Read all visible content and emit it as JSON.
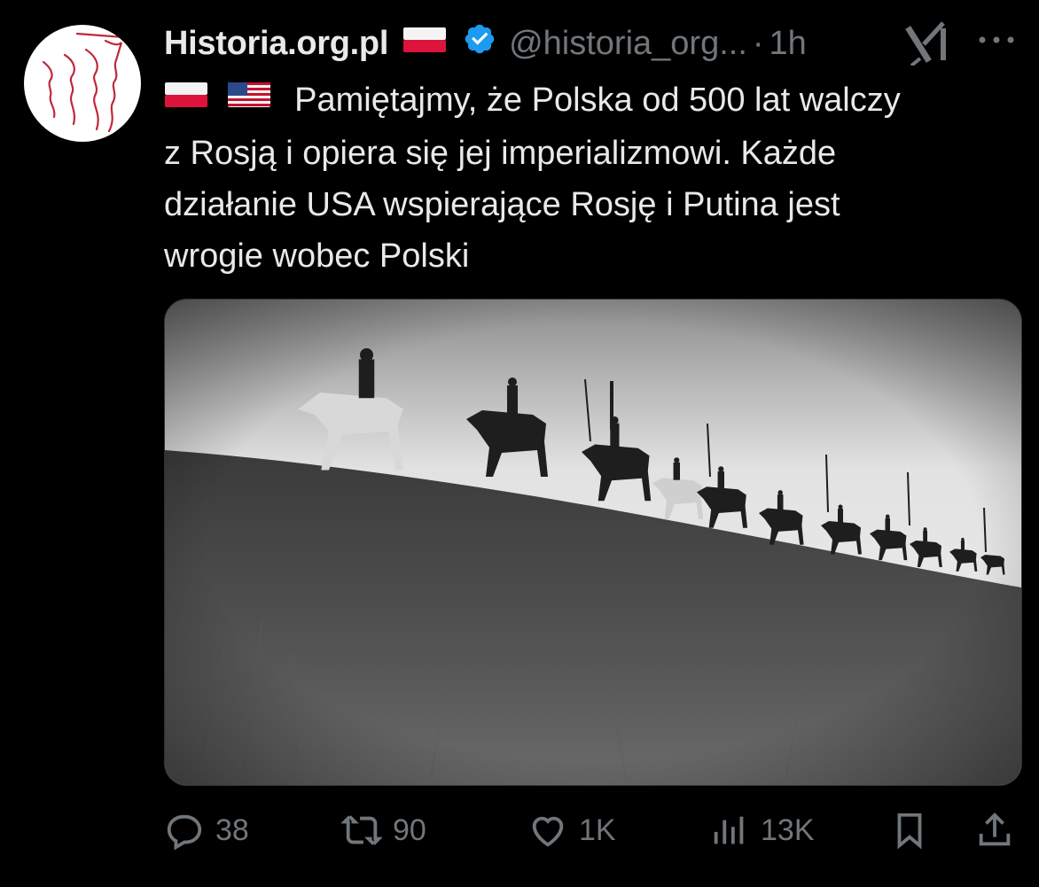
{
  "author": {
    "name": "Historia.org.pl",
    "handle": "@historia_org...",
    "separator": "·",
    "time": "1h"
  },
  "tweet": {
    "text_line1": "Pamiętajmy, że Polska od 500 lat walczy",
    "text_line2": "z Rosją i opiera się jej imperializmowi. Każde",
    "text_line3": "działanie USA wspierające Rosję i Putina jest",
    "text_line4": "wrogie wobec Polski"
  },
  "actions": {
    "replies": "38",
    "reposts": "90",
    "likes": "1K",
    "views": "13K"
  },
  "icons": [
    "verified-icon",
    "grok-icon",
    "more-icon",
    "reply-icon",
    "repost-icon",
    "like-icon",
    "views-icon",
    "bookmark-icon",
    "share-icon"
  ],
  "colors": {
    "background": "#000000",
    "text": "#e7e9ea",
    "muted": "#71767b",
    "verified": "#1d9bf0",
    "flag_red": "#dc143c"
  }
}
